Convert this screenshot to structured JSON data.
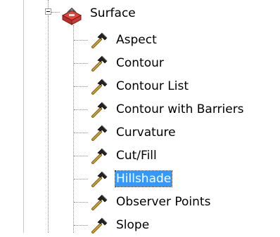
{
  "tree": {
    "parent": {
      "label": "Surface",
      "expanded": true,
      "icon": "toolbox-icon"
    },
    "items": [
      {
        "label": "Aspect",
        "icon": "hammer-icon",
        "selected": false
      },
      {
        "label": "Contour",
        "icon": "hammer-icon",
        "selected": false
      },
      {
        "label": "Contour List",
        "icon": "hammer-icon",
        "selected": false
      },
      {
        "label": "Contour with Barriers",
        "icon": "hammer-icon",
        "selected": false
      },
      {
        "label": "Curvature",
        "icon": "hammer-icon",
        "selected": false
      },
      {
        "label": "Cut/Fill",
        "icon": "hammer-icon",
        "selected": false
      },
      {
        "label": "Hillshade",
        "icon": "hammer-icon",
        "selected": true
      },
      {
        "label": "Observer Points",
        "icon": "hammer-icon",
        "selected": false
      },
      {
        "label": "Slope",
        "icon": "hammer-icon",
        "selected": false
      }
    ]
  },
  "colors": {
    "selection": "#3399ff",
    "selection_text": "#ffffff",
    "toolbox_red": "#e0443c",
    "hammer_head": "#222222",
    "hammer_handle": "#c9a23a"
  }
}
